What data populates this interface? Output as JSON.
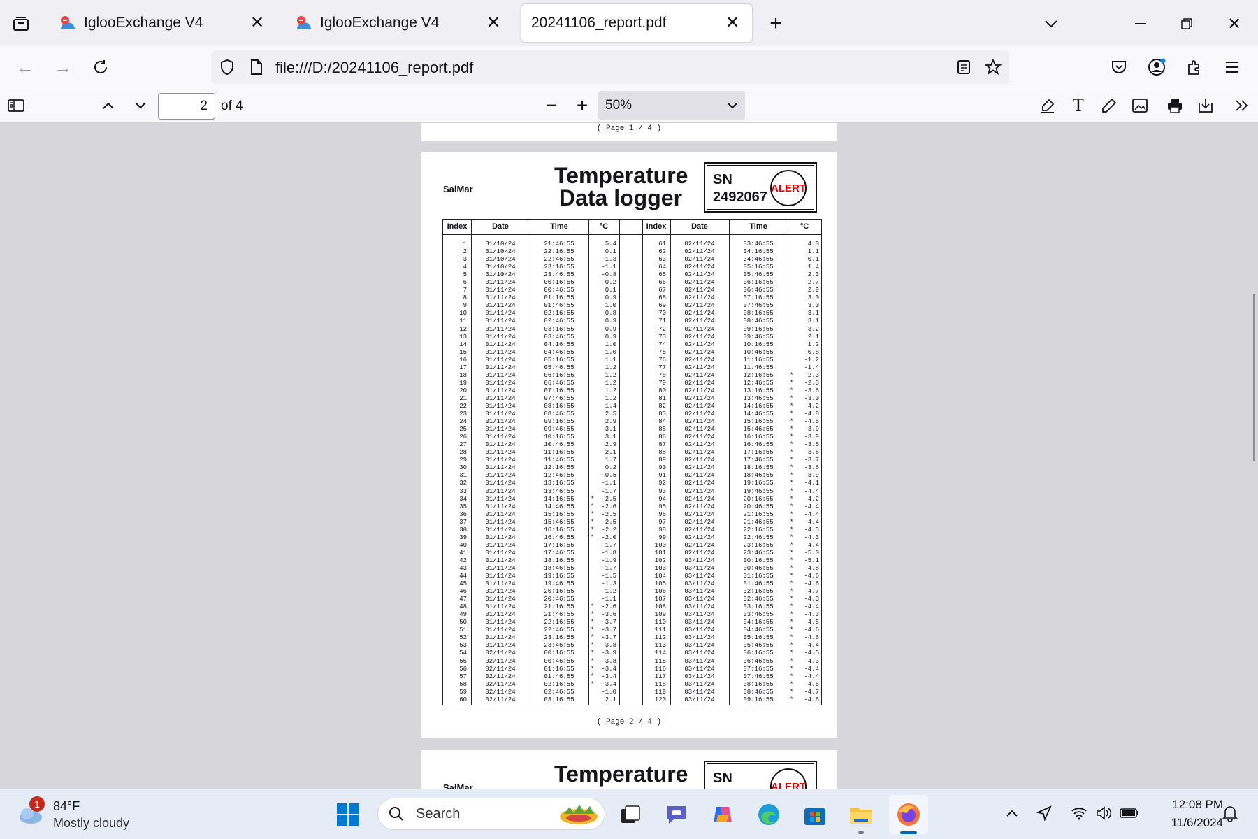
{
  "tabs": [
    {
      "title": "IglooExchange V4"
    },
    {
      "title": "IglooExchange V4"
    },
    {
      "title": "20241106_report.pdf"
    }
  ],
  "url": "file:///D:/20241106_report.pdf",
  "pdf_toolbar": {
    "page_number": "2",
    "page_count": "of 4",
    "zoom": "50%"
  },
  "document": {
    "page1_footer": "( Page   1 / 4 )",
    "page2_footer": "( Page   2 / 4 )",
    "company": "SalMar",
    "title_line1": "Temperature",
    "title_line2": "Data logger",
    "sn_label": "SN",
    "sn_value": "2492067",
    "alert": "ALERT",
    "headers": [
      "Index",
      "Date",
      "Time",
      "°C",
      "Index",
      "Date",
      "Time",
      "°C"
    ],
    "left_columns": {
      "index": "1\n2\n3\n4\n5\n6\n7\n8\n9\n10\n11\n12\n13\n14\n15\n16\n17\n18\n19\n20\n21\n22\n23\n24\n25\n26\n27\n28\n29\n30\n31\n32\n33\n34\n35\n36\n37\n38\n39\n40\n41\n42\n43\n44\n45\n46\n47\n48\n49\n50\n51\n52\n53\n54\n55\n56\n57\n58\n59\n60",
      "date": "31/10/24\n31/10/24\n31/10/24\n31/10/24\n31/10/24\n01/11/24\n01/11/24\n01/11/24\n01/11/24\n01/11/24\n01/11/24\n01/11/24\n01/11/24\n01/11/24\n01/11/24\n01/11/24\n01/11/24\n01/11/24\n01/11/24\n01/11/24\n01/11/24\n01/11/24\n01/11/24\n01/11/24\n01/11/24\n01/11/24\n01/11/24\n01/11/24\n01/11/24\n01/11/24\n01/11/24\n01/11/24\n01/11/24\n01/11/24\n01/11/24\n01/11/24\n01/11/24\n01/11/24\n01/11/24\n01/11/24\n01/11/24\n01/11/24\n01/11/24\n01/11/24\n01/11/24\n01/11/24\n01/11/24\n01/11/24\n01/11/24\n01/11/24\n01/11/24\n01/11/24\n01/11/24\n02/11/24\n02/11/24\n02/11/24\n02/11/24\n02/11/24\n02/11/24\n02/11/24",
      "time": "21:46:55\n22:16:55\n22:46:55\n23:16:55\n23:46:55\n00:16:55\n00:46:55\n01:16:55\n01:46:55\n02:16:55\n02:46:55\n03:16:55\n03:46:55\n04:16:55\n04:46:55\n05:16:55\n05:46:55\n06:16:55\n06:46:55\n07:16:55\n07:46:55\n08:16:55\n08:46:55\n09:16:55\n09:46:55\n10:16:55\n10:46:55\n11:16:55\n11:46:55\n12:16:55\n12:46:55\n13:16:55\n13:46:55\n14:16:55\n14:46:55\n15:16:55\n15:46:55\n16:16:55\n16:46:55\n17:16:55\n17:46:55\n18:16:55\n18:46:55\n19:16:55\n19:46:55\n20:16:55\n20:46:55\n21:16:55\n21:46:55\n22:16:55\n22:46:55\n23:16:55\n23:46:55\n00:16:55\n00:46:55\n01:16:55\n01:46:55\n02:16:55\n02:46:55\n03:16:55",
      "marker": "\n\n\n\n\n\n\n\n\n\n\n\n\n\n\n\n\n\n\n\n\n\n\n\n\n\n\n\n\n\n\n\n\n*\n*\n*\n*\n*\n*\n\n\n\n\n\n\n\n\n*\n*\n*\n*\n*\n*\n*\n*\n*\n*\n*\n\n",
      "temp": "5.4\n0.1\n-1.3\n-1.1\n-0.8\n-0.2\n0.1\n0.9\n1.0\n0.8\n0.9\n0.9\n0.9\n1.0\n1.0\n1.1\n1.2\n1.2\n1.2\n1.2\n1.2\n1.4\n2.5\n2.9\n3.1\n3.1\n2.9\n2.1\n1.7\n0.2\n-0.5\n-1.1\n-1.7\n-2.5\n-2.6\n-2.5\n-2.5\n-2.2\n-2.0\n-1.7\n-1.8\n-1.9\n-1.7\n-1.5\n-1.3\n-1.2\n-1.1\n-2.6\n-3.6\n-3.7\n-3.7\n-3.7\n-3.8\n-3.9\n-3.8\n-3.4\n-3.4\n-3.4\n-1.0\n2.1"
    },
    "right_columns": {
      "index": "61\n62\n63\n64\n65\n66\n67\n68\n69\n70\n71\n72\n73\n74\n75\n76\n77\n78\n79\n80\n81\n82\n83\n84\n85\n86\n87\n88\n89\n90\n91\n92\n93\n94\n95\n96\n97\n98\n99\n100\n101\n102\n103\n104\n105\n106\n107\n108\n109\n110\n111\n112\n113\n114\n115\n116\n117\n118\n119\n120",
      "date": "02/11/24\n02/11/24\n02/11/24\n02/11/24\n02/11/24\n02/11/24\n02/11/24\n02/11/24\n02/11/24\n02/11/24\n02/11/24\n02/11/24\n02/11/24\n02/11/24\n02/11/24\n02/11/24\n02/11/24\n02/11/24\n02/11/24\n02/11/24\n02/11/24\n02/11/24\n02/11/24\n02/11/24\n02/11/24\n02/11/24\n02/11/24\n02/11/24\n02/11/24\n02/11/24\n02/11/24\n02/11/24\n02/11/24\n02/11/24\n02/11/24\n02/11/24\n02/11/24\n02/11/24\n02/11/24\n02/11/24\n02/11/24\n03/11/24\n03/11/24\n03/11/24\n03/11/24\n03/11/24\n03/11/24\n03/11/24\n03/11/24\n03/11/24\n03/11/24\n03/11/24\n03/11/24\n03/11/24\n03/11/24\n03/11/24\n03/11/24\n03/11/24\n03/11/24\n03/11/24",
      "time": "03:46:55\n04:16:55\n04:46:55\n05:16:55\n05:46:55\n06:16:55\n06:46:55\n07:16:55\n07:46:55\n08:16:55\n08:46:55\n09:16:55\n09:46:55\n10:16:55\n10:46:55\n11:16:55\n11:46:55\n12:16:55\n12:46:55\n13:16:55\n13:46:55\n14:16:55\n14:46:55\n15:16:55\n15:46:55\n16:16:55\n16:46:55\n17:16:55\n17:46:55\n18:16:55\n18:46:55\n19:16:55\n19:46:55\n20:16:55\n20:46:55\n21:16:55\n21:46:55\n22:16:55\n22:46:55\n23:16:55\n23:46:55\n00:16:55\n00:46:55\n01:16:55\n01:46:55\n02:16:55\n02:46:55\n03:16:55\n03:46:55\n04:16:55\n04:46:55\n05:16:55\n05:46:55\n06:16:55\n06:46:55\n07:16:55\n07:46:55\n08:16:55\n08:46:55\n09:16:55",
      "marker": "\n\n\n\n\n\n\n\n\n\n\n\n\n\n\n\n\n*\n*\n*\n*\n*\n*\n*\n*\n*\n*\n*\n*\n*\n*\n*\n*\n*\n*\n*\n*\n*\n*\n*\n*\n*\n*\n*\n*\n*\n*\n*\n*\n*\n*\n*\n*\n*\n*\n*\n*\n*\n*\n*",
      "temp": "4.0\n1.1\n0.1\n1.4\n2.3\n2.7\n2.9\n3.0\n3.0\n3.1\n3.1\n3.2\n2.1\n1.2\n-0.8\n-1.2\n-1.4\n-2.3\n-2.3\n-3.6\n-3.0\n-4.2\n-4.8\n-4.5\n-3.9\n-3.9\n-3.5\n-3.6\n-3.7\n-3.6\n-3.9\n-4.1\n-4.4\n-4.2\n-4.4\n-4.4\n-4.4\n-4.3\n-4.3\n-4.4\n-5.0\n-5.1\n-4.8\n-4.6\n-4.6\n-4.7\n-4.3\n-4.4\n-4.3\n-4.5\n-4.6\n-4.6\n-4.4\n-4.5\n-4.3\n-4.4\n-4.4\n-4.5\n-4.7\n-4.6"
    },
    "next_company": "SalMar",
    "next_title": "Temperature",
    "next_sn_label": "SN",
    "next_alert": "ALERT"
  },
  "taskbar": {
    "weather_temp": "84°F",
    "weather_desc": "Mostly cloudy",
    "weather_badge": "1",
    "search_placeholder": "Search",
    "time": "12:08 PM",
    "date": "11/6/2024"
  }
}
